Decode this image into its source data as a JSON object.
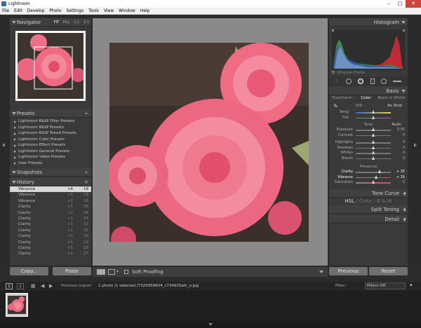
{
  "window": {
    "title": "Lightroom"
  },
  "menu": [
    "File",
    "Edit",
    "Develop",
    "Photo",
    "Settings",
    "Tools",
    "View",
    "Window",
    "Help"
  ],
  "navigator": {
    "title": "Navigator",
    "modes": [
      "FIT",
      "FILL",
      "1:1",
      "3:1"
    ]
  },
  "presets": {
    "title": "Presets",
    "items": [
      "Lightroom B&W Filter Presets",
      "Lightroom B&W Presets",
      "Lightroom B&W Toned Presets",
      "Lightroom Color Presets",
      "Lightroom Effect Presets",
      "Lightroom General Presets",
      "Lightroom Video Presets",
      "User Presets"
    ]
  },
  "snapshots": {
    "title": "Snapshots"
  },
  "history": {
    "title": "History",
    "rows": [
      {
        "name": "Vibrance",
        "delta": "+4",
        "value": "18"
      },
      {
        "name": "Vibrance",
        "delta": "+1",
        "value": "18"
      },
      {
        "name": "Vibrance",
        "delta": "+1",
        "value": "18"
      },
      {
        "name": "Clarity",
        "delta": "+1",
        "value": "35"
      },
      {
        "name": "Clarity",
        "delta": "+1",
        "value": "34"
      },
      {
        "name": "Clarity",
        "delta": "+1",
        "value": "33"
      },
      {
        "name": "Clarity",
        "delta": "+1",
        "value": "32"
      },
      {
        "name": "Clarity",
        "delta": "+1",
        "value": "31"
      },
      {
        "name": "Clarity",
        "delta": "+1",
        "value": "30"
      },
      {
        "name": "Clarity",
        "delta": "+1",
        "value": "29"
      },
      {
        "name": "Clarity",
        "delta": "+1",
        "value": "28"
      },
      {
        "name": "Clarity",
        "delta": "+1",
        "value": "27"
      }
    ]
  },
  "left_buttons": {
    "copy": "Copy...",
    "paste": "Paste"
  },
  "toolbar": {
    "soft_proofing": "Soft Proofing"
  },
  "histogram": {
    "title": "Histogram",
    "original_photo": "Original Photo"
  },
  "basic": {
    "title": "Basic",
    "treatment_label": "Treatment :",
    "treatment_color": "Color",
    "treatment_bw": "Black & White",
    "wb_label": "WB :",
    "wb_value": "As Shot",
    "temp_label": "Temp",
    "tint_label": "Tint",
    "tone_label": "Tone",
    "auto_label": "Auto",
    "tone_sliders": [
      {
        "label": "Exposure",
        "value": "0.00"
      },
      {
        "label": "Contrast",
        "value": "0"
      },
      {
        "label": "Highlights",
        "value": "0"
      },
      {
        "label": "Shadows",
        "value": "0"
      },
      {
        "label": "Whites",
        "value": "0"
      },
      {
        "label": "Blacks",
        "value": "0"
      }
    ],
    "presence_label": "Presence",
    "presence_sliders": [
      {
        "label": "Clarity",
        "value": "+ 35"
      },
      {
        "label": "Vibrance",
        "value": "+ 15"
      },
      {
        "label": "Saturation",
        "value": "0"
      }
    ]
  },
  "tone_curve": {
    "title": "Tone Curve"
  },
  "hsl": {
    "hsl": "HSL",
    "color": "Color",
    "bw": "B & W"
  },
  "split_toning": {
    "title": "Split Toning"
  },
  "detail": {
    "title": "Detail"
  },
  "right_buttons": {
    "previous": "Previous",
    "reset": "Reset"
  },
  "filmstrip": {
    "page1": "1",
    "page2": "2",
    "source": "Previous Import",
    "info": "1 photo /1 selected /7320958604_c734925afc_o.jpg",
    "filter_label": "Filter :",
    "filter_value": "Filters Off"
  }
}
